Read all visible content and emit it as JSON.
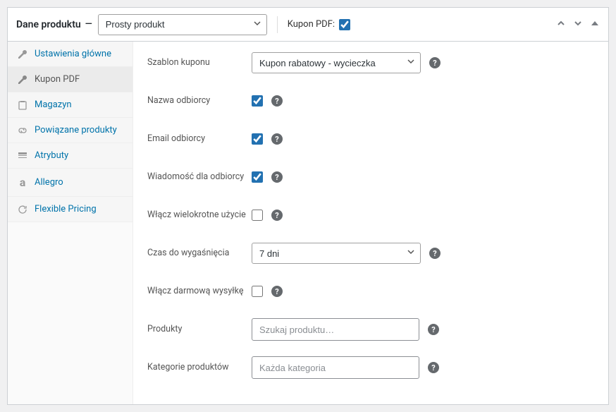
{
  "header": {
    "title": "Dane produktu",
    "dash": "—",
    "product_type": "Prosty produkt",
    "kupon_label": "Kupon PDF:",
    "kupon_checked": true
  },
  "tabs": [
    {
      "label": "Ustawienia główne"
    },
    {
      "label": "Kupon PDF"
    },
    {
      "label": "Magazyn"
    },
    {
      "label": "Powiązane produkty"
    },
    {
      "label": "Atrybuty"
    },
    {
      "label": "Allegro"
    },
    {
      "label": "Flexible Pricing"
    }
  ],
  "fields": {
    "template": {
      "label": "Szablon kuponu",
      "value": "Kupon rabatowy - wycieczka"
    },
    "recipient_name": {
      "label": "Nazwa odbiorcy",
      "checked": true
    },
    "recipient_email": {
      "label": "Email odbiorcy",
      "checked": true
    },
    "recipient_msg": {
      "label": "Wiadomość dla odbiorcy",
      "checked": true
    },
    "multi_use": {
      "label": "Włącz wielokrotne użycie",
      "checked": false
    },
    "expiry": {
      "label": "Czas do wygaśnięcia",
      "value": "7 dni"
    },
    "free_shipping": {
      "label": "Włącz darmową wysyłkę",
      "checked": false
    },
    "products": {
      "label": "Produkty",
      "placeholder": "Szukaj produktu…"
    },
    "categories": {
      "label": "Kategorie produktów",
      "placeholder": "Każda kategoria"
    }
  }
}
